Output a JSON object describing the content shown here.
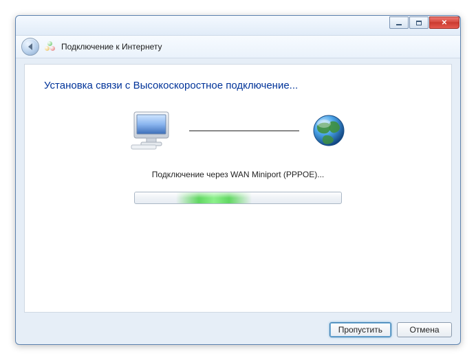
{
  "window": {
    "title": "Подключение к Интернету"
  },
  "content": {
    "heading": "Установка связи с Высокоскоростное подключение...",
    "status": "Подключение через WAN Miniport (PPPOE)..."
  },
  "buttons": {
    "skip": "Пропустить",
    "cancel": "Отмена"
  }
}
